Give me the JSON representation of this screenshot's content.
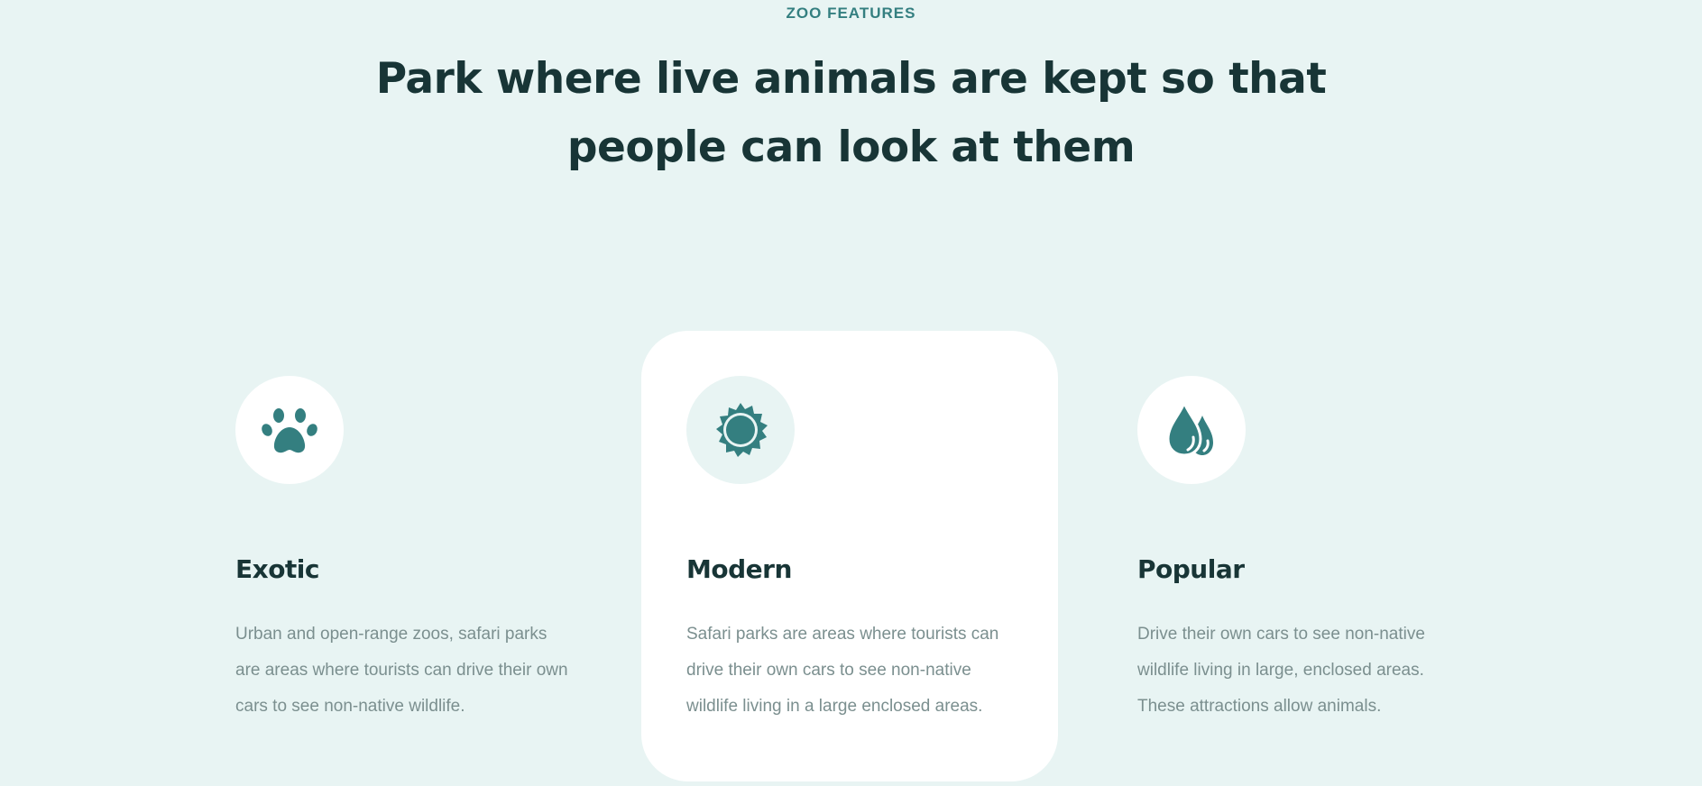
{
  "section": {
    "eyebrow": "ZOO FEATURES",
    "heading_line1": "Park where live animals are kept so that",
    "heading_line2": "people can look at them"
  },
  "colors": {
    "background": "#e8f4f3",
    "accent": "#347f80",
    "heading": "#183536",
    "body_text": "#7b8f8f",
    "card_active": "#ffffff"
  },
  "features": [
    {
      "icon": "paw-icon",
      "title": "Exotic",
      "text": "Urban and open-range zoos, safari parks are areas where tourists can drive their own cars to see non-native wildlife.",
      "active": false
    },
    {
      "icon": "sun-icon",
      "title": "Modern",
      "text": "Safari parks are areas where tourists can drive their own cars to see non-native wildlife living in a large enclosed areas.",
      "active": true
    },
    {
      "icon": "droplets-icon",
      "title": "Popular",
      "text": "Drive their own cars to see non-native wildlife living in large, enclosed areas. These attractions allow animals.",
      "active": false
    }
  ]
}
